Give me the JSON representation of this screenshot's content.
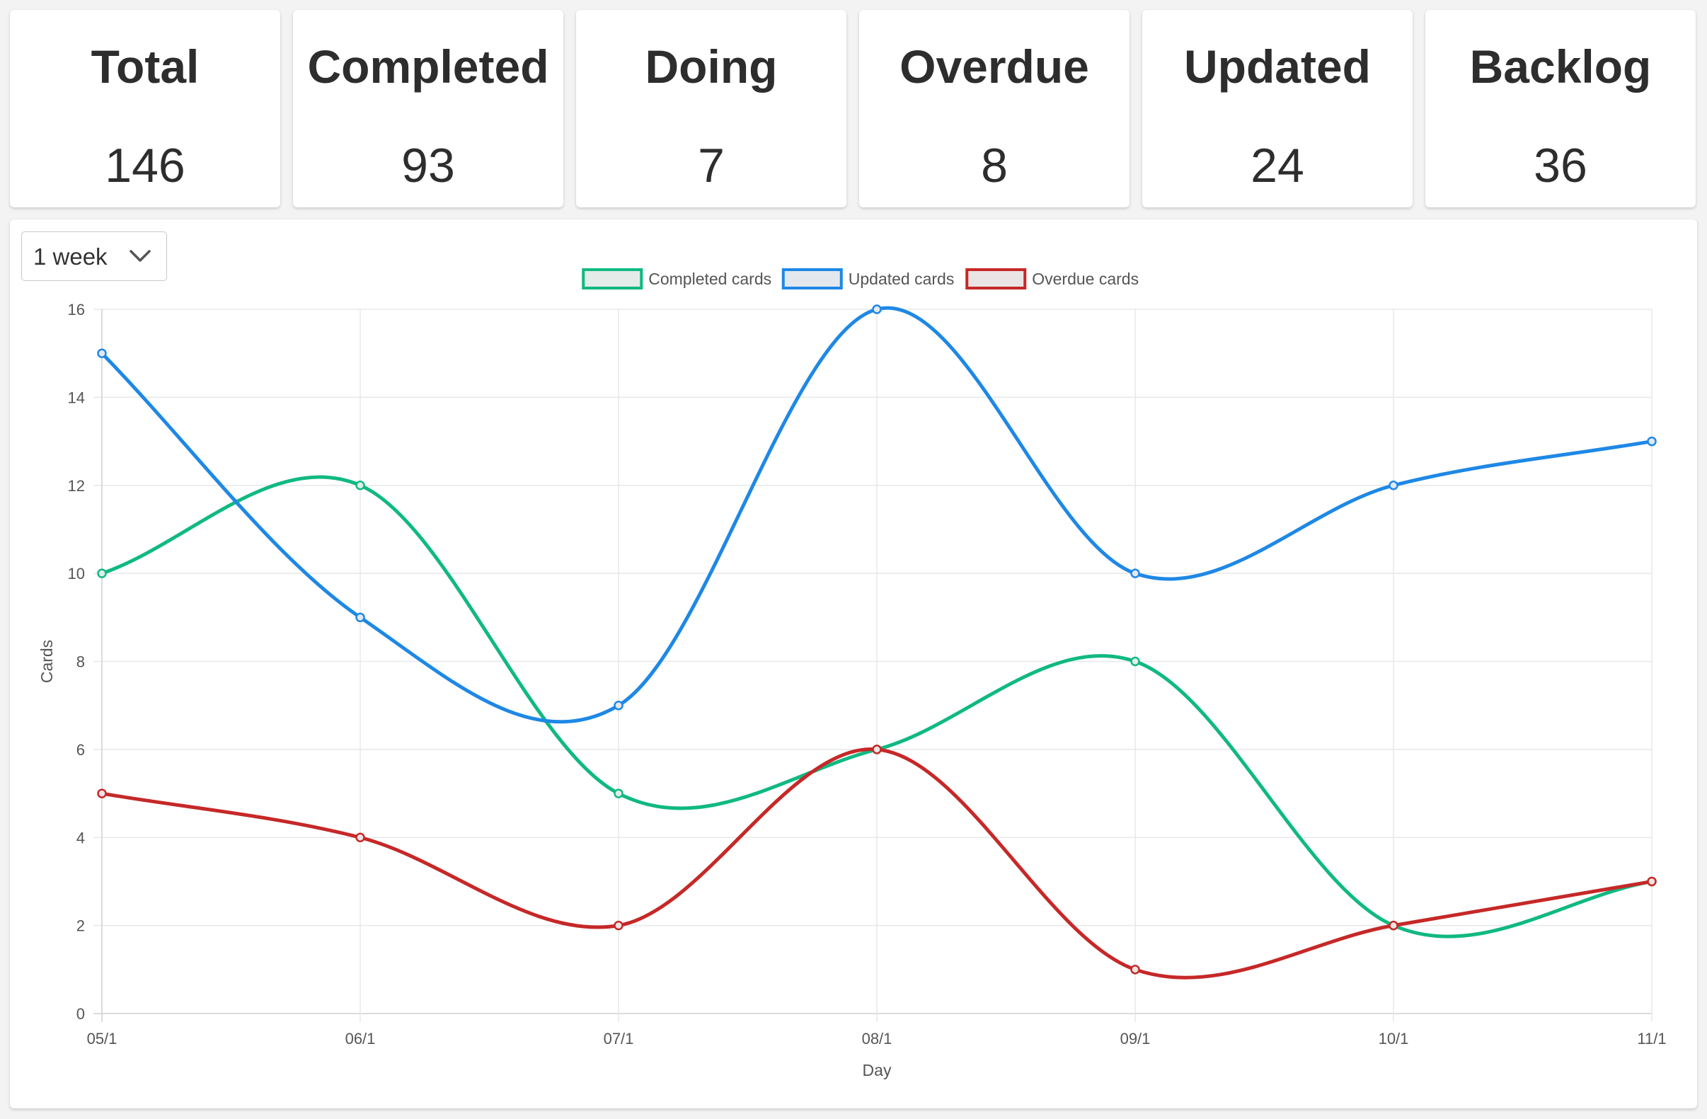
{
  "stats": [
    {
      "label": "Total",
      "value": "146"
    },
    {
      "label": "Completed",
      "value": "93"
    },
    {
      "label": "Doing",
      "value": "7"
    },
    {
      "label": "Overdue",
      "value": "8"
    },
    {
      "label": "Updated",
      "value": "24"
    },
    {
      "label": "Backlog",
      "value": "36"
    }
  ],
  "range_select": {
    "value": "1 week",
    "icon": "chevron-down-icon"
  },
  "chart_data": {
    "type": "line",
    "x": [
      "05/1",
      "06/1",
      "07/1",
      "08/1",
      "09/1",
      "10/1",
      "11/1"
    ],
    "xlabel": "Day",
    "ylabel": "Cards",
    "ylim": [
      0,
      16
    ],
    "yticks": [
      0,
      2,
      4,
      6,
      8,
      10,
      12,
      14,
      16
    ],
    "grid": true,
    "legend_position": "top-center",
    "series": [
      {
        "name": "Completed cards",
        "color": "#10b981",
        "fill": "#e3ece8",
        "values": [
          10,
          12,
          5,
          6,
          8,
          2,
          3
        ]
      },
      {
        "name": "Updated cards",
        "color": "#1e88e5",
        "fill": "#e3e8ee",
        "values": [
          15,
          9,
          7,
          16,
          10,
          12,
          13
        ]
      },
      {
        "name": "Overdue cards",
        "color": "#c62828",
        "fill": "#ebe4e4",
        "values": [
          5,
          4,
          2,
          6,
          1,
          2,
          3
        ]
      }
    ]
  }
}
